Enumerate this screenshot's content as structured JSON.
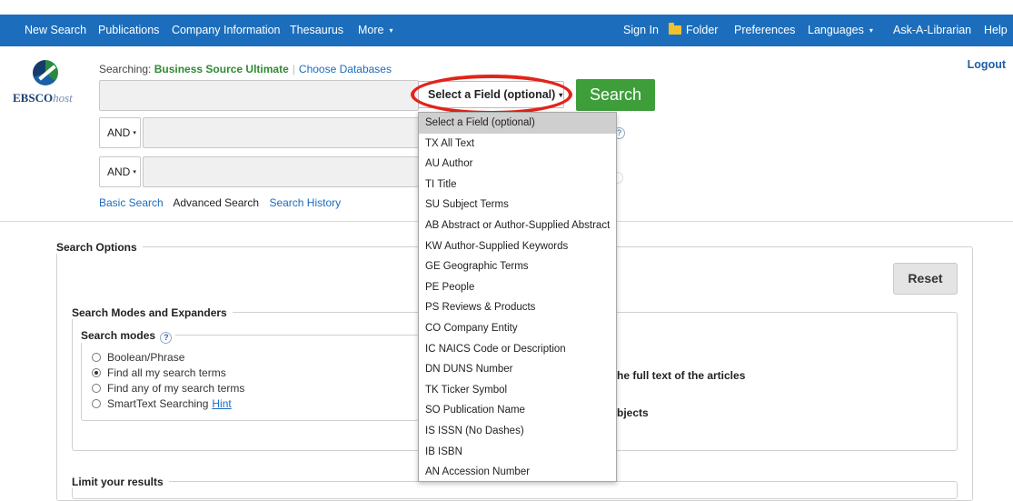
{
  "nav": {
    "left": [
      "New Search",
      "Publications",
      "Company Information",
      "Thesaurus",
      "More"
    ],
    "right": [
      "Sign In",
      "Folder",
      "Preferences",
      "Languages",
      "Ask-A-Librarian",
      "Help"
    ]
  },
  "logo": {
    "brand": "EBSCO",
    "suffix": "host"
  },
  "logout": "Logout",
  "searching": {
    "prefix": "Searching:",
    "database": "Business Source Ultimate",
    "choose": "Choose Databases"
  },
  "field_select": {
    "label": "Select a Field (optional)"
  },
  "search_button": "Search",
  "bool_ops": [
    "AND",
    "AND"
  ],
  "links": {
    "basic": "Basic Search",
    "advanced": "Advanced Search",
    "history": "Search History"
  },
  "search_options": {
    "title": "Search Options",
    "reset": "Reset",
    "modes_section": "Search Modes and Expanders",
    "modes_title": "Search modes",
    "modes": [
      {
        "label": "Boolean/Phrase",
        "selected": false
      },
      {
        "label": "Find all my search terms",
        "selected": true
      },
      {
        "label": "Find any of my search terms",
        "selected": false
      },
      {
        "label": "SmartText Searching",
        "selected": false
      }
    ],
    "hint": "Hint",
    "partial_text_1": "he full text of the articles",
    "partial_text_2": "bjects",
    "limit_title": "Limit your results"
  },
  "dropdown": {
    "items": [
      "Select a Field (optional)",
      "TX All Text",
      "AU Author",
      "TI Title",
      "SU Subject Terms",
      "AB Abstract or Author-Supplied Abstract",
      "KW Author-Supplied Keywords",
      "GE Geographic Terms",
      "PE People",
      "PS Reviews & Products",
      "CO Company Entity",
      "IC NAICS Code or Description",
      "DN DUNS Number",
      "TK Ticker Symbol",
      "SO Publication Name",
      "IS ISSN (No Dashes)",
      "IB ISBN",
      "AN Accession Number"
    ],
    "selected_index": 0
  },
  "colors": {
    "nav": "#1c6ebc",
    "search_button": "#3e9e3a",
    "highlight": "#e2231a",
    "database": "#2f8a35"
  }
}
